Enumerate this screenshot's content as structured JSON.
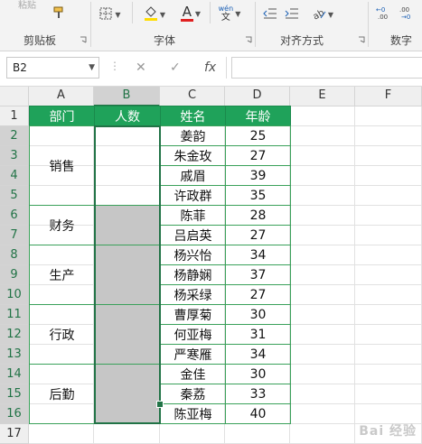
{
  "ribbon": {
    "faded_top_label": "粘贴",
    "groups": [
      {
        "label": "剪贴板"
      },
      {
        "label": "字体"
      },
      {
        "label": "对齐方式"
      },
      {
        "label": "数字"
      }
    ],
    "pinyin_label": "wén",
    "font_color_letter": "A",
    "accent_red": "#e02020",
    "accent_yellow": "#ffdd00"
  },
  "formula_bar": {
    "name_box": "B2",
    "fx_label": "fx",
    "formula_value": ""
  },
  "columns": [
    "A",
    "B",
    "C",
    "D",
    "E",
    "F"
  ],
  "rows": [
    "1",
    "2",
    "3",
    "4",
    "5",
    "6",
    "7",
    "8",
    "9",
    "10",
    "11",
    "12",
    "13",
    "14",
    "15",
    "16",
    "17"
  ],
  "headers": {
    "dept": "部门",
    "count": "人数",
    "name": "姓名",
    "age": "年龄"
  },
  "departments": [
    "销售",
    "财务",
    "生产",
    "行政",
    "后勤"
  ],
  "people": [
    {
      "name": "姜韵",
      "age": "25"
    },
    {
      "name": "朱金玫",
      "age": "27"
    },
    {
      "name": "戚眉",
      "age": "39"
    },
    {
      "name": "许政群",
      "age": "35"
    },
    {
      "name": "陈菲",
      "age": "28"
    },
    {
      "name": "吕启英",
      "age": "27"
    },
    {
      "name": "杨兴怡",
      "age": "34"
    },
    {
      "name": "杨静娴",
      "age": "37"
    },
    {
      "name": "杨采绿",
      "age": "27"
    },
    {
      "name": "曹厚菊",
      "age": "30"
    },
    {
      "name": "何亚梅",
      "age": "31"
    },
    {
      "name": "严寒雁",
      "age": "34"
    },
    {
      "name": "金佳",
      "age": "30"
    },
    {
      "name": "秦荔",
      "age": "33"
    },
    {
      "name": "陈亚梅",
      "age": "40"
    }
  ],
  "colors": {
    "header_green": "#1fa25a",
    "border_green": "#3aa15a",
    "selected_gray": "#c6c6c6",
    "excel_green": "#217346"
  },
  "watermark": "Bai 经验"
}
